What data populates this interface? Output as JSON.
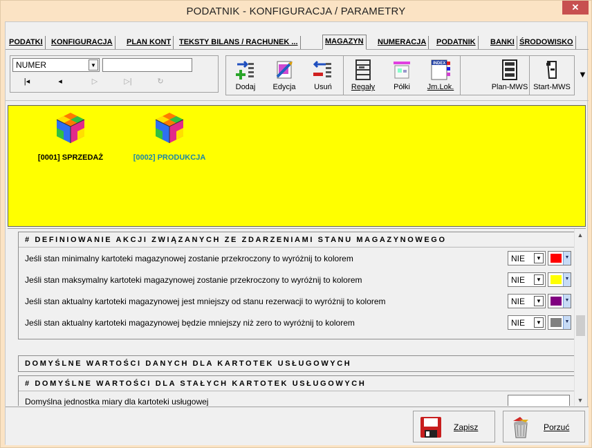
{
  "window": {
    "title": "PODATNIK  - KONFIGURACJA / PARAMETRY",
    "close": "✕"
  },
  "tabs": [
    {
      "label": "PODATKI"
    },
    {
      "label": "KONFIGURACJA"
    },
    {
      "label": "PLAN KONT"
    },
    {
      "label": "TEKSTY BILANS / RACHUNEK ..."
    },
    {
      "label": "MAGAZYN",
      "active": true
    },
    {
      "label": "NUMERACJA"
    },
    {
      "label": "PODATNIK"
    },
    {
      "label": "BANKI"
    },
    {
      "label": "ŚRODOWISKO"
    }
  ],
  "navigator": {
    "field_value": "NUMER",
    "search_value": "",
    "buttons": [
      "|◂",
      "◂",
      "▷",
      "▷|",
      "↻"
    ]
  },
  "toolbar": {
    "add": "Dodaj",
    "edit": "Edycja",
    "delete": "Usuń",
    "racks": "Regały",
    "shelves": "Półki",
    "loc_units": "Jm.Lok.",
    "plan_mws": "Plan-MWS",
    "start_mws": "Start-MWS",
    "more": "▼"
  },
  "warehouses": [
    {
      "label": "[0001] SPRZEDAŻ",
      "color": "#000000"
    },
    {
      "label": "[0002] PRODUKCJA",
      "color": "#1a86a8"
    }
  ],
  "stock_actions": {
    "title": "# DEFINIOWANIE AKCJI ZWIĄZANYCH ZE ZDARZENIAMI STANU MAGAZYNOWEGO",
    "rows": [
      {
        "text": "Jeśli stan minimalny kartoteki magazynowej zostanie przekroczony to wyróżnij to kolorem",
        "value": "NIE",
        "color": "#ff0000"
      },
      {
        "text": "Jeśli stan maksymalny kartoteki magazynowej zostanie przekroczony to wyróżnij to kolorem",
        "value": "NIE",
        "color": "#ffff00"
      },
      {
        "text": "Jeśli stan aktualny kartoteki magazynowej jest mniejszy od stanu rezerwacji to wyróżnij to kolorem",
        "value": "NIE",
        "color": "#800080"
      },
      {
        "text": "Jeśli stan aktualny kartoteki magazynowej będzie mniejszy niż zero to wyróżnij to kolorem",
        "value": "NIE",
        "color": "#808080"
      }
    ]
  },
  "service_defaults": {
    "title": "DOMYŚLNE  WARTOŚCI DANYCH DLA KARTOTEK USŁUGOWYCH"
  },
  "service_fixed": {
    "title": "# DOMYŚLNE  WARTOŚCI DLA STAŁYCH KARTOTEK USŁUGOWYCH",
    "first_row_text": "Domyślna jednostka miary dla kartoteki usługowej"
  },
  "actions": {
    "save": "Zapisz",
    "cancel": "Porzuć"
  }
}
